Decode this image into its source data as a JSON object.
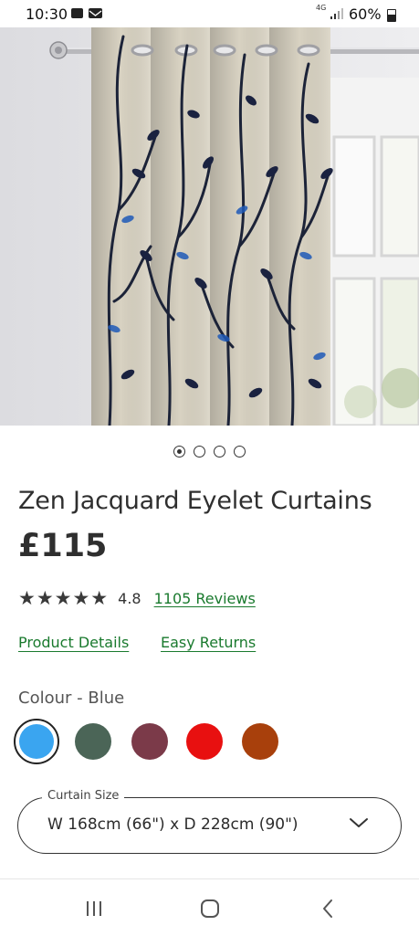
{
  "status_bar": {
    "time": "10:30",
    "network": "4G",
    "battery": "60%",
    "icons": [
      "gallery-icon",
      "mail-icon",
      "signal-icon",
      "battery-icon"
    ]
  },
  "product": {
    "title": "Zen Jacquard Eyelet Curtains",
    "price": "£115",
    "rating_stars": "★★★★★",
    "rating_value": "4.8",
    "reviews_link": "1105 Reviews",
    "carousel": {
      "count": 4,
      "active_index": 0
    }
  },
  "links": {
    "details": "Product Details",
    "returns": "Easy Returns"
  },
  "colour": {
    "label": "Colour - Blue",
    "swatches": [
      {
        "name": "Blue",
        "hex": "#3aa5f0",
        "selected": true
      },
      {
        "name": "Green",
        "hex": "#4b6557",
        "selected": false
      },
      {
        "name": "Plum",
        "hex": "#7b3a49",
        "selected": false
      },
      {
        "name": "Red",
        "hex": "#e81010",
        "selected": false
      },
      {
        "name": "Orange",
        "hex": "#a8400c",
        "selected": false
      }
    ]
  },
  "size": {
    "legend": "Curtain Size",
    "value": "W 168cm (66\") x D 228cm (90\")"
  },
  "accent": "#1a7a2e",
  "nav_icons": [
    "recent-apps-icon",
    "home-icon",
    "back-icon"
  ]
}
